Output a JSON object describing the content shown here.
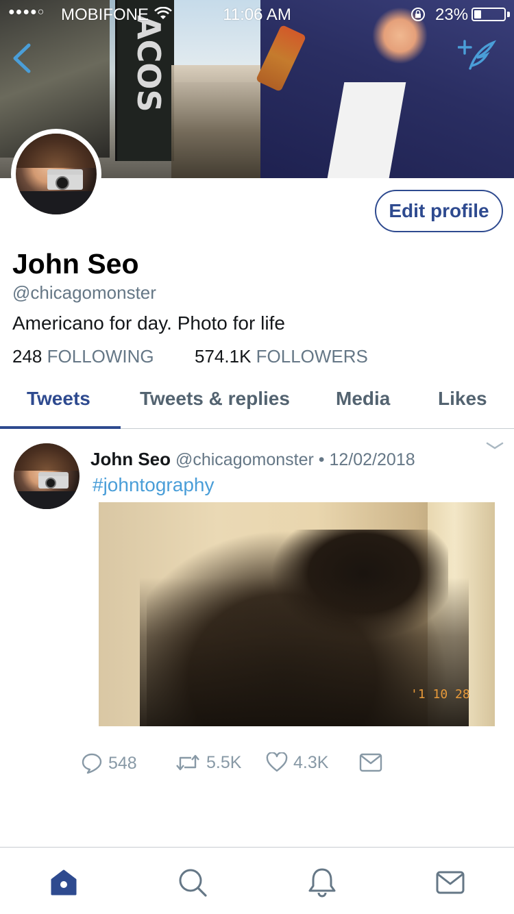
{
  "status_bar": {
    "signal": "●●●●○",
    "carrier": "MOBIFONE",
    "time": "11:06 AM",
    "battery_pct": "23%",
    "battery_level": 0.23
  },
  "banner": {
    "flag_text": "ACOS"
  },
  "profile": {
    "name": "John Seo",
    "handle": "@chicagomonster",
    "bio": "Americano for day. Photo for life",
    "edit_button": "Edit profile",
    "following_count": "248",
    "following_label": "FOLLOWING",
    "followers_count": "574.1K",
    "followers_label": "FOLLOWERS"
  },
  "tabs": [
    {
      "label": "Tweets",
      "active": true
    },
    {
      "label": "Tweets & replies",
      "active": false
    },
    {
      "label": "Media",
      "active": false
    },
    {
      "label": "Likes",
      "active": false
    }
  ],
  "tweet": {
    "name": "John Seo",
    "handle": "@chicagomonster",
    "separator": "•",
    "date": "12/02/2018",
    "hashtag": "#johntography",
    "photo_stamp": "'1 10 28",
    "replies": "548",
    "retweets": "5.5K",
    "likes": "4.3K"
  },
  "bottom_nav": [
    "home-icon",
    "search-icon",
    "notifications-icon",
    "messages-icon"
  ],
  "colors": {
    "brand": "#2e4a8f",
    "link": "#4a9ed8",
    "secondary_text": "#657786"
  }
}
